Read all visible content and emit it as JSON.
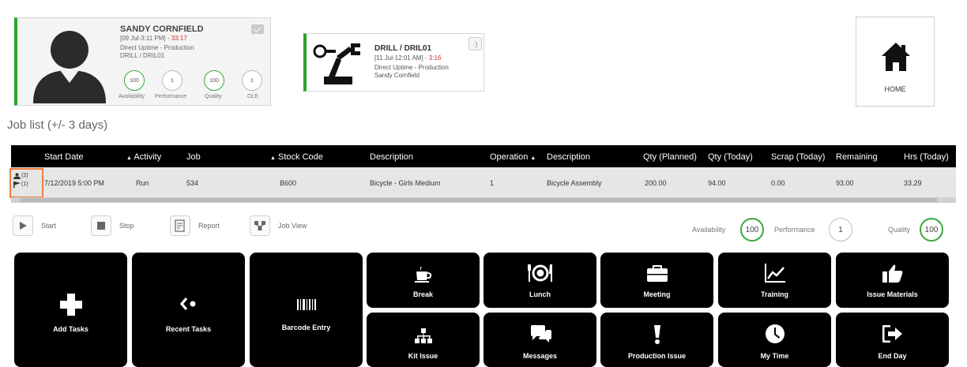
{
  "operator": {
    "name": "SANDY CORNFIELD",
    "time_prefix": "[09 Jul-3:11 PM] - ",
    "time_elapsed": "33:17",
    "status": "Direct Uptime - Production",
    "machine": "DRILL / DRIL01",
    "metrics": [
      {
        "value": "100",
        "label": "Availability",
        "state": "green"
      },
      {
        "value": "1",
        "label": "Performance",
        "state": "grey"
      },
      {
        "value": "100",
        "label": "Quality",
        "state": "green"
      },
      {
        "value": "1",
        "label": "OLE",
        "state": "grey"
      }
    ]
  },
  "machine_card": {
    "title": "DRILL / DRIL01",
    "time_prefix": "[11 Jul-12:01 AM] - ",
    "time_elapsed": "3:16",
    "status": "Direct Uptime - Production",
    "operator": "Sandy Cornfield"
  },
  "home": {
    "label": "HOME"
  },
  "job_list": {
    "title": "Job list (+/- 3 days)",
    "headers": [
      "Start Date",
      "Activity",
      "Job",
      "Stock Code",
      "Description",
      "Operation",
      "Description",
      "Qty (Planned)",
      "Qty (Today)",
      "Scrap (Today)",
      "Remaining",
      "Hrs (Today)"
    ],
    "sorted_marker": "▲",
    "row": {
      "status_people": "(2)",
      "status_flags": "(1)",
      "cells": [
        "7/12/2019 5:00 PM",
        "Run",
        "534",
        "B600",
        "Bicycle - Girls Medium",
        "1",
        "Bicycle Assembly",
        "200.00",
        "94.00",
        "0.00",
        "93.00",
        "33.29"
      ]
    }
  },
  "actions": [
    {
      "label": "Start",
      "icon": "play-icon"
    },
    {
      "label": "Stop",
      "icon": "stop-icon"
    },
    {
      "label": "Report",
      "icon": "report-icon"
    },
    {
      "label": "Job View",
      "icon": "job-view-icon"
    }
  ],
  "kpis": [
    {
      "label": "Availability",
      "value": "100",
      "state": "green"
    },
    {
      "label": "Performance",
      "value": "1",
      "state": "grey"
    },
    {
      "label": "Quality",
      "value": "100",
      "state": "green"
    }
  ],
  "tiles": {
    "add_tasks": "Add Tasks",
    "recent_tasks": "Recent Tasks",
    "barcode_entry": "Barcode Entry",
    "break": "Break",
    "lunch": "Lunch",
    "meeting": "Meeting",
    "training": "Training",
    "issue_materials": "Issue Materials",
    "kit_issue": "Kit Issue",
    "messages": "Messages",
    "production_issue": "Production Issue",
    "my_time": "My Time",
    "end_day": "End Day"
  },
  "colors": {
    "accent_green": "#2aa52a",
    "alert_red": "#e02a2a",
    "tile_bg": "#000000",
    "selection_orange": "#f07d3a"
  }
}
